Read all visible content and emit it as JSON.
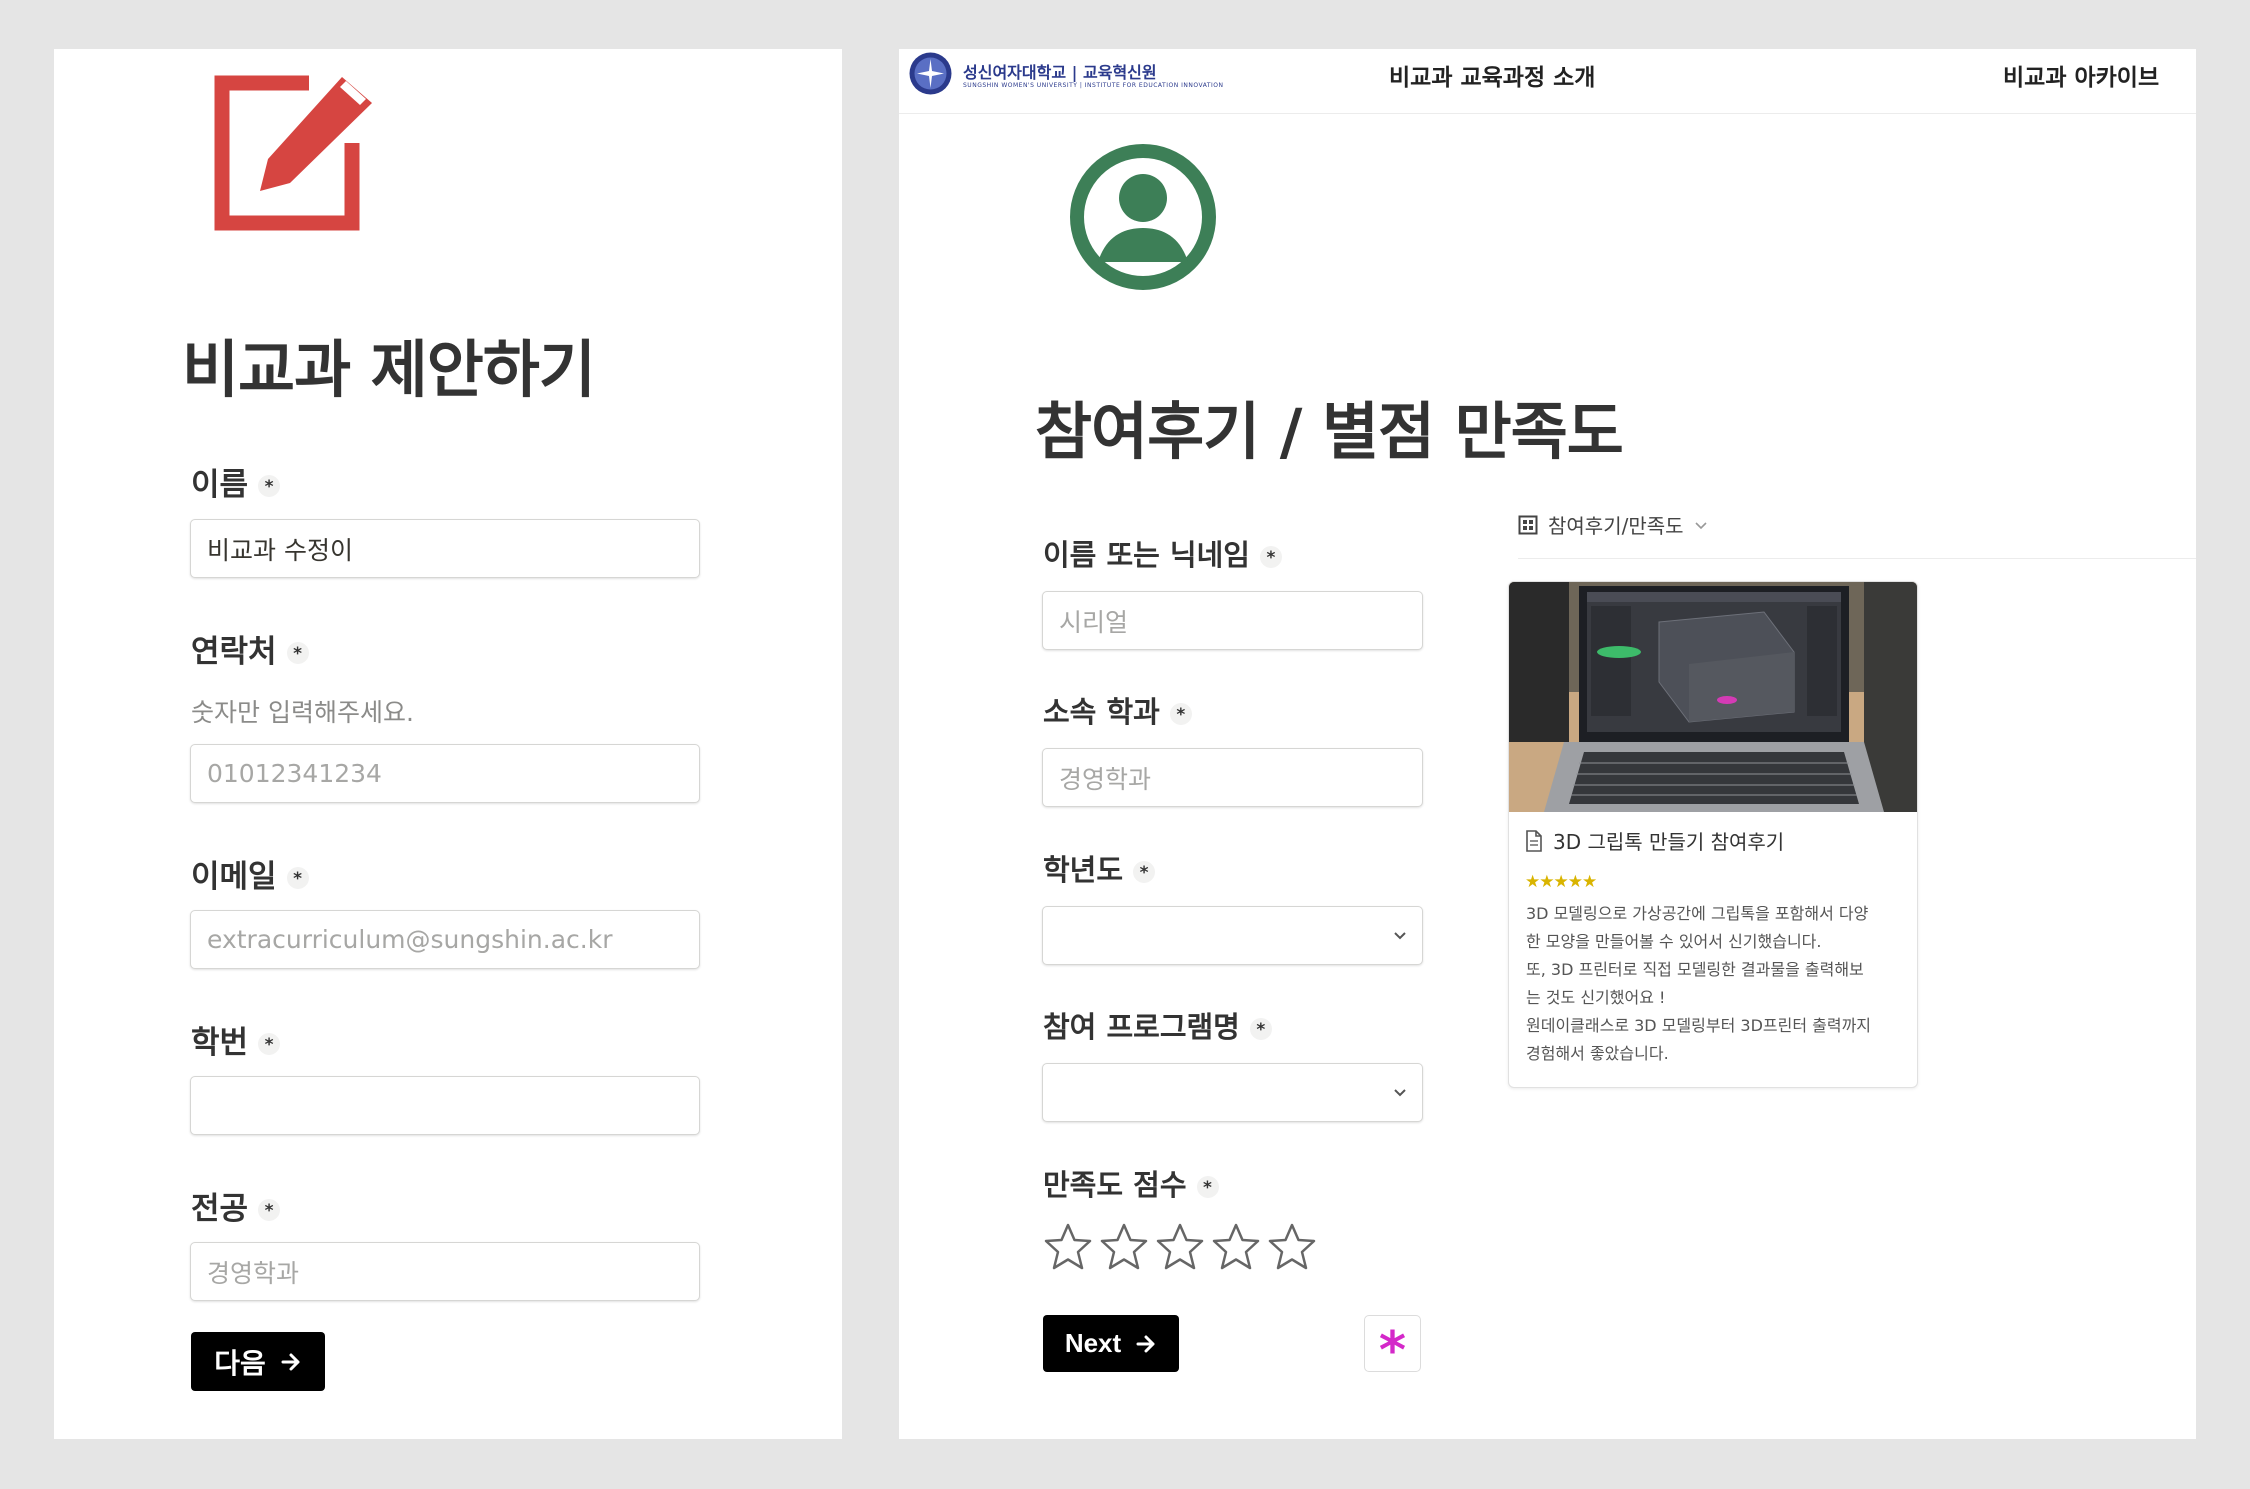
{
  "colors": {
    "edit_icon": "#d64541",
    "avatar_icon": "#3d7f57",
    "button_bg": "#000000",
    "asterisk": "#d428c9",
    "rating_star": "#d9b400"
  },
  "left_form": {
    "icon": "edit-icon",
    "title": "비교과 제안하기",
    "fields": [
      {
        "label": "이름",
        "required": true,
        "value": "비교과 수정이",
        "placeholder": ""
      },
      {
        "label": "연락처",
        "required": true,
        "description": "숫자만 입력해주세요.",
        "value": "",
        "placeholder": "01012341234"
      },
      {
        "label": "이메일",
        "required": true,
        "value": "",
        "placeholder": "extracurriculum@sungshin.ac.kr"
      },
      {
        "label": "학번",
        "required": true,
        "value": "",
        "placeholder": ""
      },
      {
        "label": "전공",
        "required": true,
        "value": "",
        "placeholder": "경영학과"
      }
    ],
    "next_label": "다음"
  },
  "right_form": {
    "topbar": {
      "logo_ko": "성신여자대학교 | 교육혁신원",
      "logo_en": "SUNGSHIN WOMEN'S UNIVERSITY | INSTITUTE FOR EDUCATION INNOVATION",
      "nav": [
        "비교과 교육과정 소개",
        "비교과 아카이브"
      ]
    },
    "icon": "user-circle-icon",
    "title": "참여후기 / 별점 만족도",
    "fields": [
      {
        "label": "이름 또는 닉네임",
        "required": true,
        "placeholder": "시리얼"
      },
      {
        "label": "소속 학과",
        "required": true,
        "placeholder": "경영학과"
      },
      {
        "label": "학년도",
        "required": true,
        "type": "select",
        "value": ""
      },
      {
        "label": "참여 프로그램명",
        "required": true,
        "type": "select",
        "value": ""
      },
      {
        "label": "만족도 점수",
        "required": true,
        "type": "rating",
        "max": 5,
        "value": 0
      }
    ],
    "next_label": "Next",
    "gallery": {
      "view_label": "참여후기/만족도",
      "card": {
        "title": "3D 그립톡 만들기 참여후기",
        "rating": "★★★★★",
        "body": [
          "3D 모델링으로 가상공간에 그립톡을 포함해서 다양",
          "한 모양을 만들어볼 수 있어서 신기했습니다.",
          "또, 3D 프린터로 직접 모델링한 결과물을 출력해보",
          "는 것도 신기했어요 !",
          "원데이클래스로 3D 모델링부터 3D프린터 출력까지",
          "경험해서 좋았습니다."
        ]
      }
    }
  }
}
